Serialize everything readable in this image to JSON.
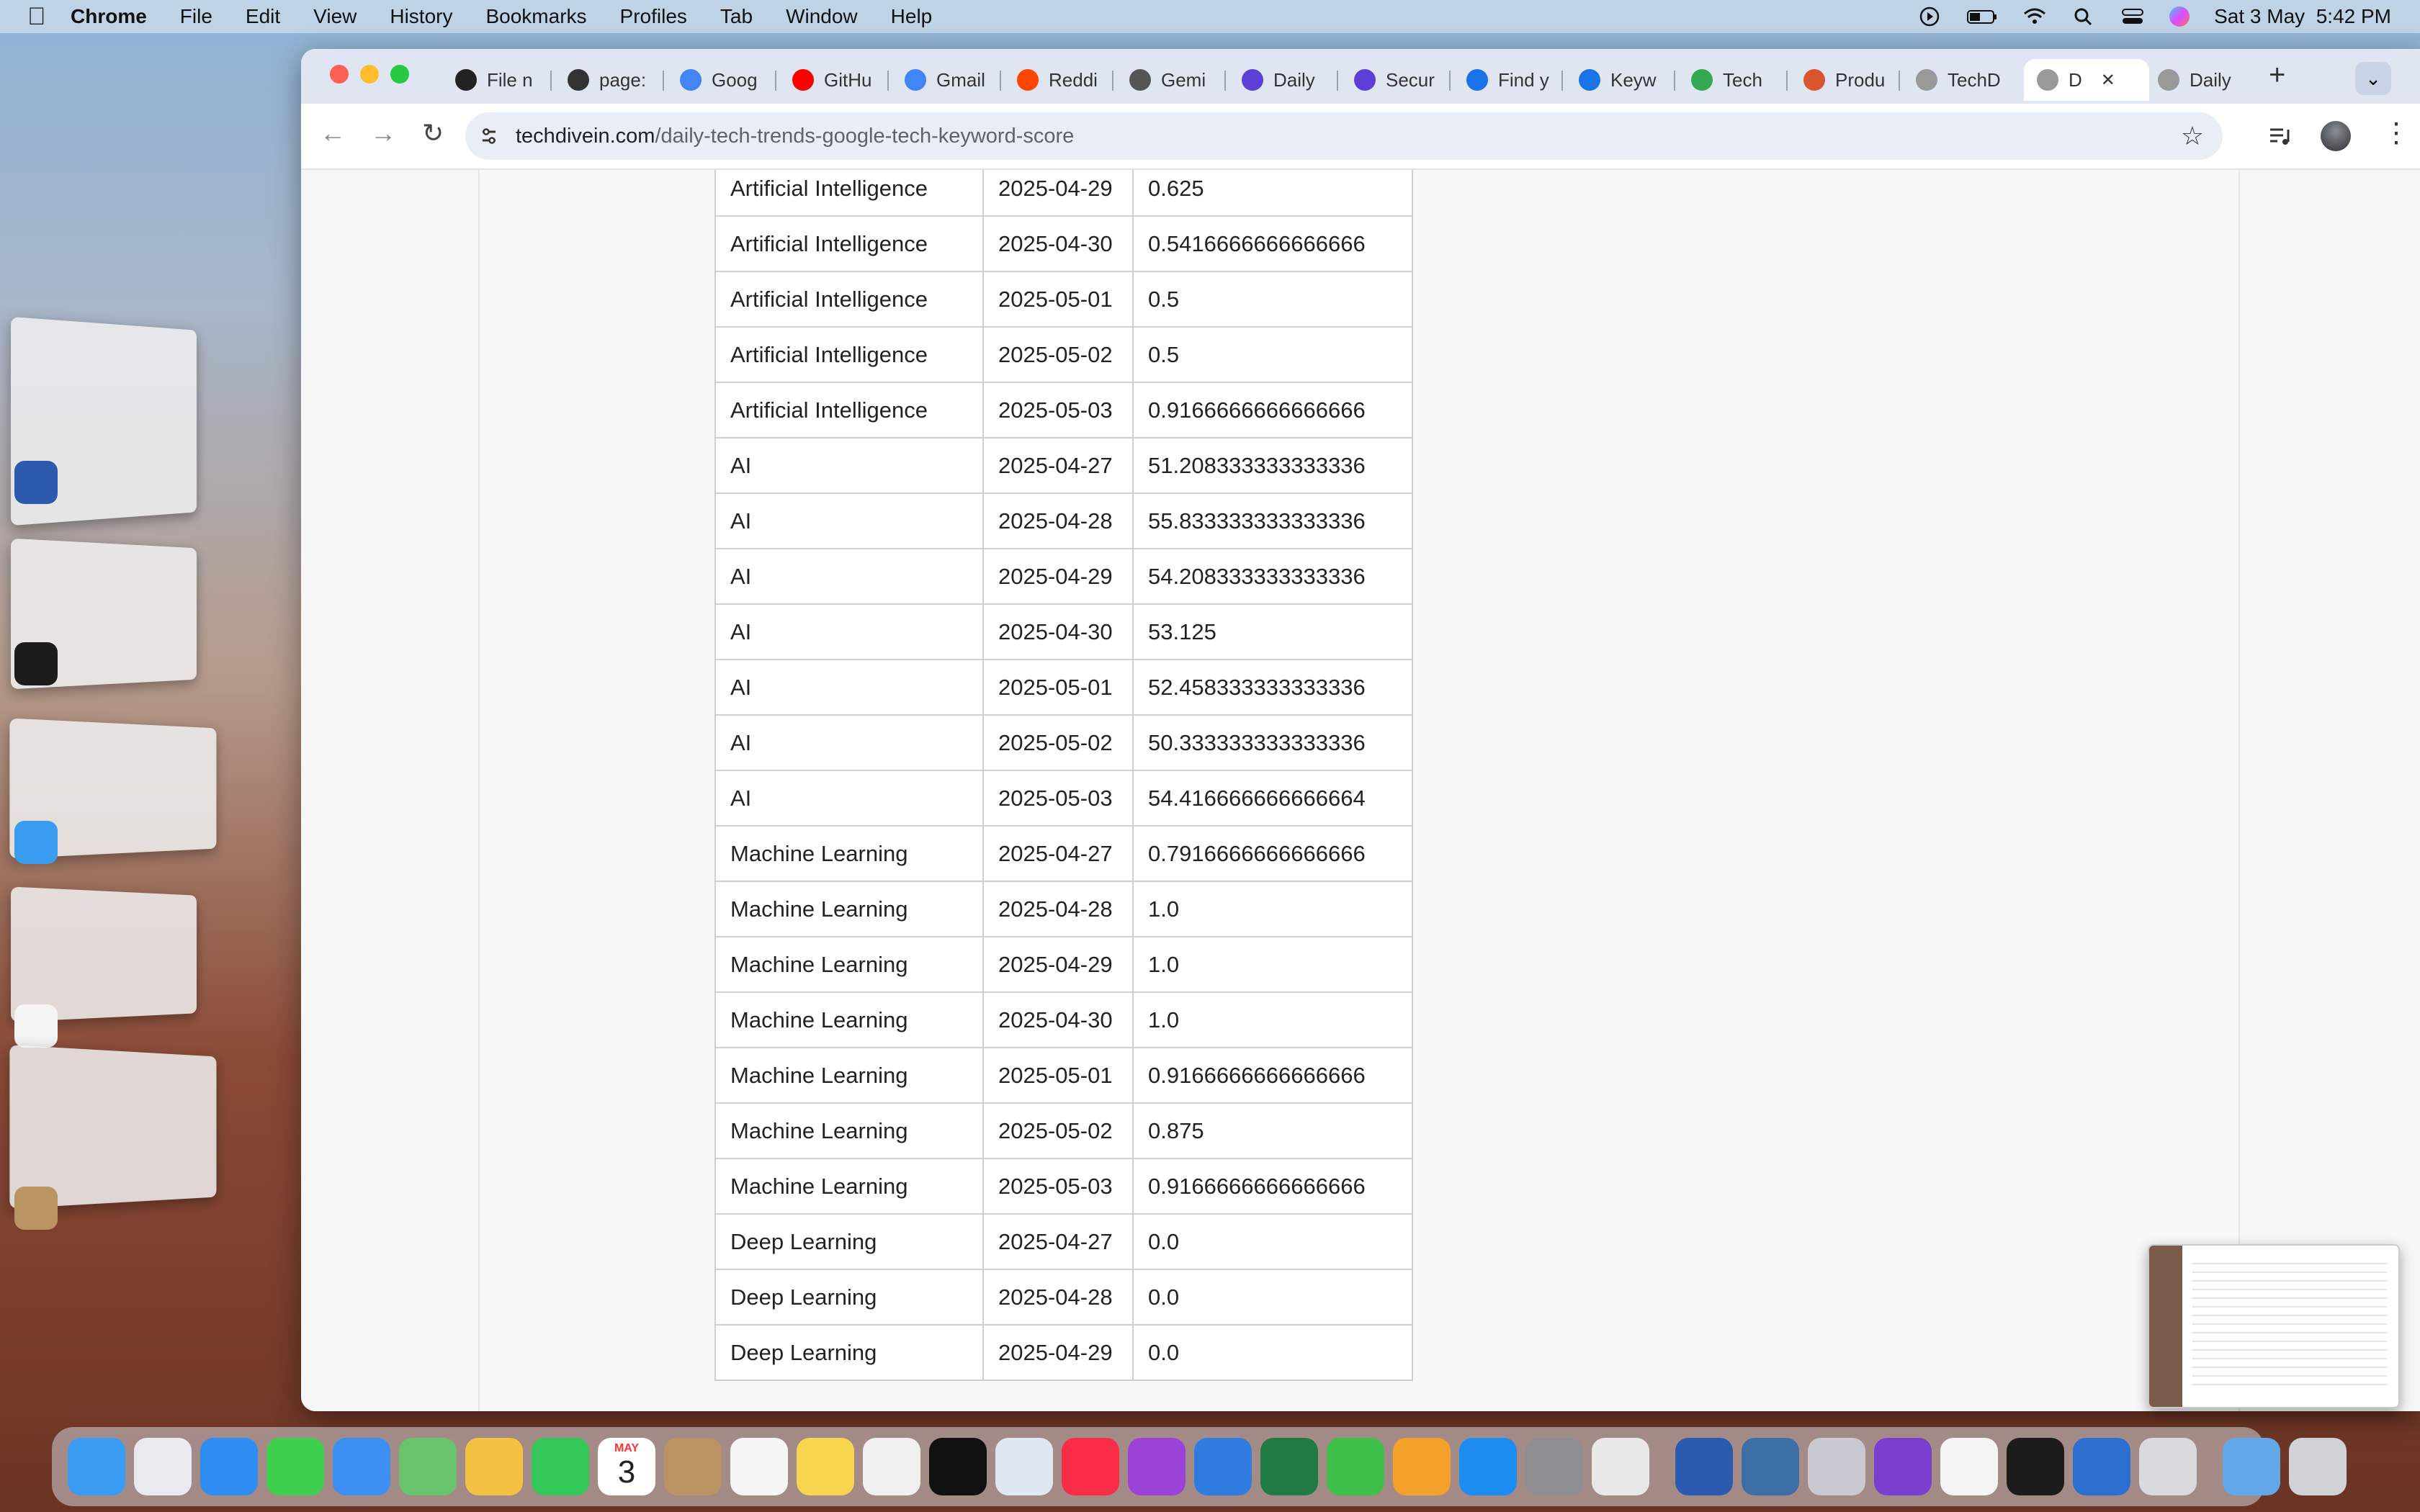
{
  "menubar": {
    "app": "Chrome",
    "menus": [
      "File",
      "Edit",
      "View",
      "History",
      "Bookmarks",
      "Profiles",
      "Tab",
      "Window",
      "Help"
    ],
    "clock": "Sat 3 May  5:42 PM"
  },
  "browser": {
    "tabs": [
      {
        "label": "File n",
        "color": "#222"
      },
      {
        "label": "page:",
        "color": "#333"
      },
      {
        "label": "Goog",
        "color": "#4285f4"
      },
      {
        "label": "GitHu",
        "color": "#ff0000"
      },
      {
        "label": "Gmail",
        "color": "#4285f4"
      },
      {
        "label": "Reddi",
        "color": "#ff4500"
      },
      {
        "label": "Gemi",
        "color": "#555"
      },
      {
        "label": "Daily",
        "color": "#5b3fd6"
      },
      {
        "label": "Secur",
        "color": "#5b3fd6"
      },
      {
        "label": "Find y",
        "color": "#1a73e8"
      },
      {
        "label": "Keyw",
        "color": "#1a73e8"
      },
      {
        "label": "Tech",
        "color": "#34a853"
      },
      {
        "label": "Produ",
        "color": "#da552f"
      },
      {
        "label": "TechD",
        "color": "#999"
      },
      {
        "label": "D",
        "color": "#999",
        "active": true
      },
      {
        "label": "Daily",
        "color": "#999"
      }
    ],
    "url_domain": "techdivein.com",
    "url_path": "/daily-tech-trends-google-tech-keyword-score",
    "new_tab": "+"
  },
  "table": {
    "rows": [
      [
        "Artificial Intelligence",
        "2025-04-29",
        "0.625"
      ],
      [
        "Artificial Intelligence",
        "2025-04-30",
        "0.5416666666666666"
      ],
      [
        "Artificial Intelligence",
        "2025-05-01",
        "0.5"
      ],
      [
        "Artificial Intelligence",
        "2025-05-02",
        "0.5"
      ],
      [
        "Artificial Intelligence",
        "2025-05-03",
        "0.9166666666666666"
      ],
      [
        "AI",
        "2025-04-27",
        "51.208333333333336"
      ],
      [
        "AI",
        "2025-04-28",
        "55.833333333333336"
      ],
      [
        "AI",
        "2025-04-29",
        "54.208333333333336"
      ],
      [
        "AI",
        "2025-04-30",
        "53.125"
      ],
      [
        "AI",
        "2025-05-01",
        "52.458333333333336"
      ],
      [
        "AI",
        "2025-05-02",
        "50.333333333333336"
      ],
      [
        "AI",
        "2025-05-03",
        "54.416666666666664"
      ],
      [
        "Machine Learning",
        "2025-04-27",
        "0.7916666666666666"
      ],
      [
        "Machine Learning",
        "2025-04-28",
        "1.0"
      ],
      [
        "Machine Learning",
        "2025-04-29",
        "1.0"
      ],
      [
        "Machine Learning",
        "2025-04-30",
        "1.0"
      ],
      [
        "Machine Learning",
        "2025-05-01",
        "0.9166666666666666"
      ],
      [
        "Machine Learning",
        "2025-05-02",
        "0.875"
      ],
      [
        "Machine Learning",
        "2025-05-03",
        "0.9166666666666666"
      ],
      [
        "Deep Learning",
        "2025-04-27",
        "0.0"
      ],
      [
        "Deep Learning",
        "2025-04-28",
        "0.0"
      ],
      [
        "Deep Learning",
        "2025-04-29",
        "0.0"
      ]
    ]
  },
  "dock": {
    "calendar_month": "MAY",
    "calendar_day": "3",
    "apps": [
      {
        "name": "finder-icon",
        "color": "#3a9cf0"
      },
      {
        "name": "launchpad-icon",
        "color": "#e9e9ef"
      },
      {
        "name": "safari-icon",
        "color": "#2f8cf0"
      },
      {
        "name": "messages-icon",
        "color": "#3ecf4f"
      },
      {
        "name": "mail-icon",
        "color": "#3d8ef2"
      },
      {
        "name": "maps-icon",
        "color": "#69c46e"
      },
      {
        "name": "photos-icon",
        "color": "#f3c243"
      },
      {
        "name": "facetime-icon",
        "color": "#34c759"
      },
      {
        "name": "calendar-icon",
        "color": "#ffffff"
      },
      {
        "name": "contacts-icon",
        "color": "#b99361"
      },
      {
        "name": "reminders-icon",
        "color": "#f5f5f5"
      },
      {
        "name": "notes-icon",
        "color": "#f7d54e"
      },
      {
        "name": "freeform-icon",
        "color": "#f0f0f0"
      },
      {
        "name": "appletv-icon",
        "color": "#111111"
      },
      {
        "name": "preview-icon",
        "color": "#dfe8f2"
      },
      {
        "name": "music-icon",
        "color": "#fa2d48"
      },
      {
        "name": "podcasts-icon",
        "color": "#9b43d6"
      },
      {
        "name": "keynote-icon",
        "color": "#2f7de1"
      },
      {
        "name": "excel-icon",
        "color": "#1f7a43"
      },
      {
        "name": "numbers-icon",
        "color": "#3fc04a"
      },
      {
        "name": "pages-icon",
        "color": "#f3a12b"
      },
      {
        "name": "appstore-icon",
        "color": "#1d8cf0"
      },
      {
        "name": "settings-icon",
        "color": "#8e8e93"
      },
      {
        "name": "chrome-icon",
        "color": "#e8e8e8"
      },
      {
        "name": "word-icon",
        "color": "#2b5aae"
      },
      {
        "name": "python-icon",
        "color": "#3b6fa5"
      },
      {
        "name": "rocket-icon",
        "color": "#c9c9d1"
      },
      {
        "name": "github-icon",
        "color": "#7b3fd0"
      },
      {
        "name": "textedit-icon",
        "color": "#f4f4f4"
      },
      {
        "name": "terminal-icon",
        "color": "#1c1c1c"
      },
      {
        "name": "xcode-icon",
        "color": "#2c6fd1"
      },
      {
        "name": "simulator-icon",
        "color": "#d9d9de"
      },
      {
        "name": "downloads-folder-icon",
        "color": "#62a8e8"
      },
      {
        "name": "trash-icon",
        "color": "#cfd3d8"
      }
    ]
  }
}
